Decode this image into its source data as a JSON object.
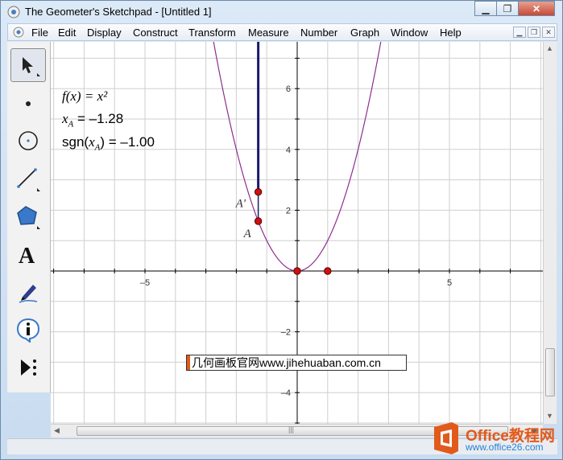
{
  "window": {
    "title": "The Geometer's Sketchpad - [Untitled 1]"
  },
  "menu": [
    "File",
    "Edit",
    "Display",
    "Construct",
    "Transform",
    "Measure",
    "Number",
    "Graph",
    "Window",
    "Help"
  ],
  "tools": [
    "arrow-select-tool",
    "point-tool",
    "compass-tool",
    "straightedge-tool",
    "polygon-tool",
    "text-tool",
    "marker-tool",
    "information-tool",
    "custom-tool"
  ],
  "measurements": {
    "function_label": "f(x) = x²",
    "xa_label": "x",
    "xa_sub": "A",
    "xa_value": " = –1.28",
    "sgn_prefix": "sgn(",
    "sgn_var": "x",
    "sgn_sub": "A",
    "sgn_suffix": ") = –1.00"
  },
  "graph": {
    "x_ticks": [
      "–5",
      "5"
    ],
    "y_ticks": [
      "6",
      "4",
      "2",
      "–2",
      "–4"
    ],
    "point_labels": [
      "A'",
      "A"
    ],
    "axis_color": "#000000",
    "curve_color": "#8e2f8e",
    "segment_color": "#1a1a6e",
    "point_color": "#cc1111"
  },
  "watermark": {
    "text": "几何画板官网www.jihehuaban.com.cn"
  },
  "logo": {
    "brand": "Office教程网",
    "url": "www.office26.com"
  },
  "colors": {
    "accent": "#e25a1b"
  }
}
